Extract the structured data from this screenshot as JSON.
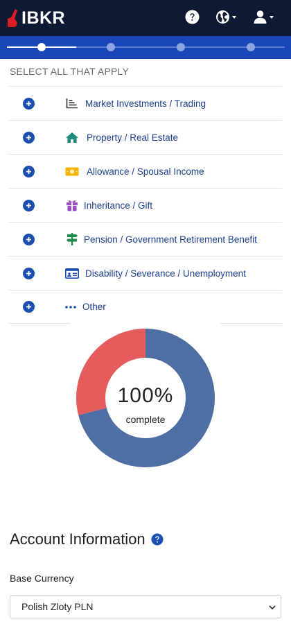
{
  "header": {
    "brand": "IBKR",
    "help_icon": "question-circle-icon",
    "language_icon": "globe-icon",
    "user_icon": "user-icon"
  },
  "stepper": {
    "steps": [
      {
        "state": "active"
      },
      {
        "state": "pending"
      },
      {
        "state": "pending"
      },
      {
        "state": "pending"
      }
    ]
  },
  "sources": {
    "instruction": "SELECT ALL THAT APPLY",
    "items": [
      {
        "label": "Market Investments / Trading",
        "icon": "chart-icon",
        "color": "#333333"
      },
      {
        "label": "Property / Real Estate",
        "icon": "house-icon",
        "color": "#1a8a7a"
      },
      {
        "label": "Allowance / Spousal Income",
        "icon": "banknote-icon",
        "color": "#f0b400"
      },
      {
        "label": "Inheritance / Gift",
        "icon": "gift-icon",
        "color": "#9b4fc4"
      },
      {
        "label": "Pension / Government Retirement Benefit",
        "icon": "signpost-icon",
        "color": "#1e8a4a"
      },
      {
        "label": "Disability / Severance / Unemployment",
        "icon": "id-card-icon",
        "color": "#1b4fb0"
      },
      {
        "label": "Other",
        "icon": "ellipsis-icon",
        "color": "#1b4fb0"
      }
    ]
  },
  "chart_data": {
    "type": "pie",
    "center_value": "100%",
    "center_label": "complete",
    "slices": [
      {
        "value": 71,
        "color": "#4e6fa3"
      },
      {
        "value": 29,
        "color": "#e55c5c"
      }
    ]
  },
  "account": {
    "title": "Account Information",
    "base_currency_label": "Base Currency",
    "base_currency_value": "Polish Zloty PLN"
  }
}
